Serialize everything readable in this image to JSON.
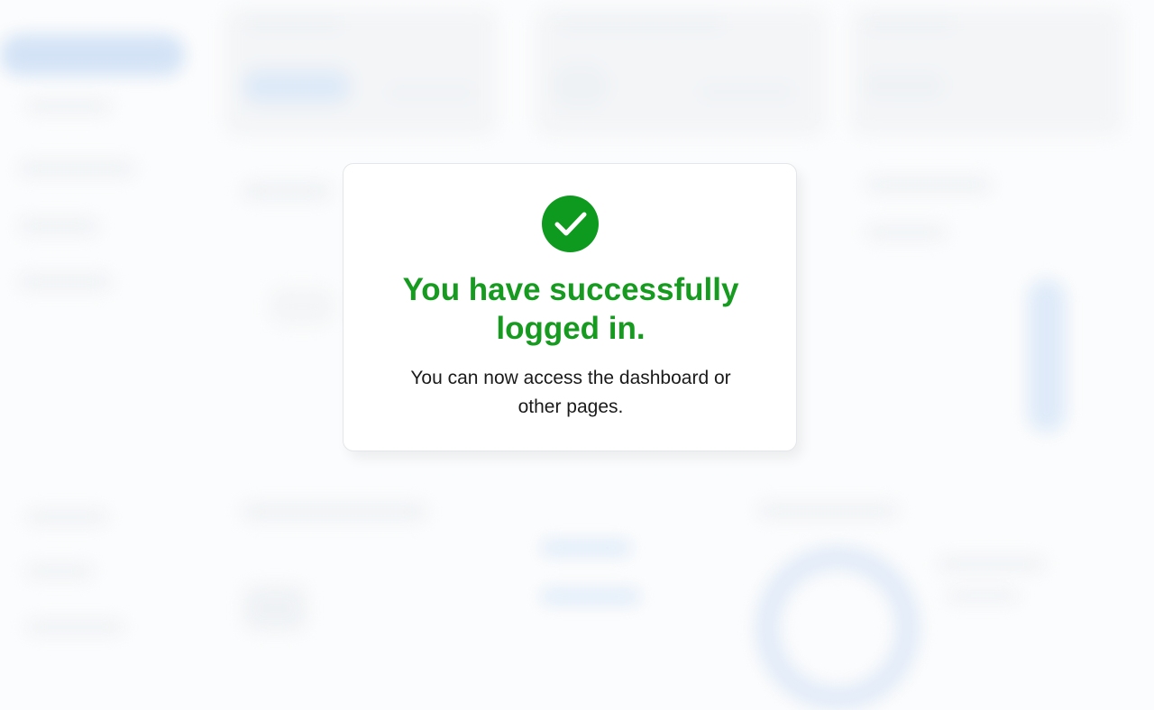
{
  "modal": {
    "icon": "check-circle-icon",
    "title": "You have successfully logged in.",
    "message": "You can now access the dashboard or other pages."
  },
  "colors": {
    "success": "#0e9a1e",
    "title_text": "#169a1f",
    "body_text": "#1a1a1a",
    "background": "#fbfcfd"
  }
}
